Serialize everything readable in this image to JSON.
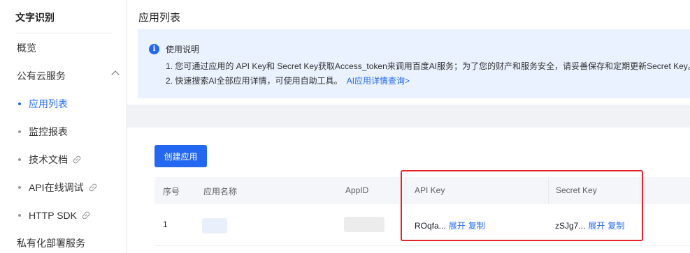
{
  "sidebar": {
    "title": "文字识别",
    "items": [
      {
        "label": "概览"
      },
      {
        "label": "公有云服务"
      },
      {
        "label": "应用列表"
      },
      {
        "label": "监控报表"
      },
      {
        "label": "技术文档"
      },
      {
        "label": "API在线调试"
      },
      {
        "label": "HTTP SDK"
      },
      {
        "label": "私有化部署服务"
      }
    ]
  },
  "header": {
    "title": "应用列表"
  },
  "notice": {
    "heading": "使用说明",
    "line1": "1. 您可通过应用的 API Key和 Secret Key获取Access_token来调用百度AI服务；为了您的财产和服务安全，请妥善保存和定期更新Secret Key。",
    "line2": "2. 快速搜索AI全部应用详情，可使用自助工具。",
    "link": "AI应用详情查询>"
  },
  "toolbar": {
    "create_label": "创建应用"
  },
  "table": {
    "headers": [
      "序号",
      "应用名称",
      "AppID",
      "API Key",
      "Secret Key"
    ],
    "rows": [
      {
        "index": "1",
        "api_key": "ROqfa...",
        "secret_key": "zSJg7...",
        "expand_label": "展开",
        "copy_label": "复制"
      }
    ]
  },
  "colors": {
    "accent": "#2468f2",
    "highlight": "#e8232b",
    "notice_bg": "#eaf2ff"
  }
}
